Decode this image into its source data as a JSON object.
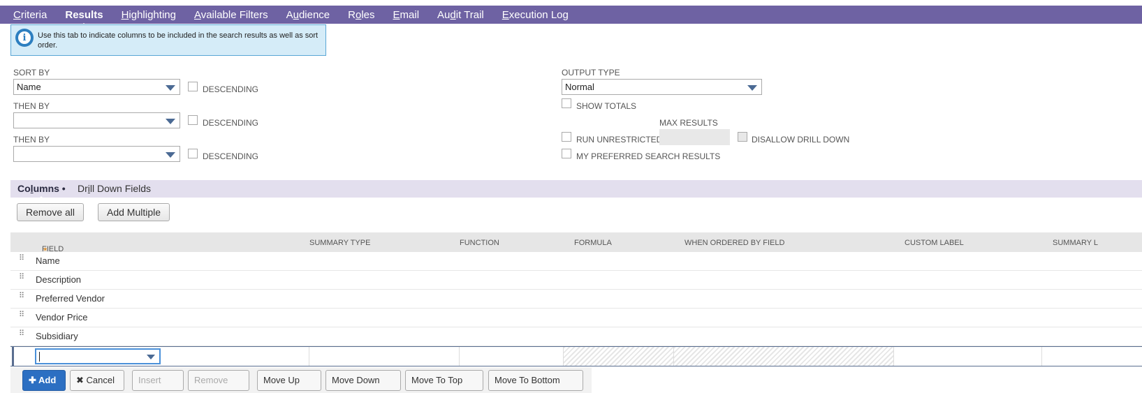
{
  "tabs": [
    {
      "pre": "",
      "u": "C",
      "post": "riteria"
    },
    {
      "pre": "",
      "u": "R",
      "post": "esults"
    },
    {
      "pre": "",
      "u": "H",
      "post": "ighlighting"
    },
    {
      "pre": "",
      "u": "A",
      "post": "vailable Filters"
    },
    {
      "pre": "A",
      "u": "u",
      "post": "dience"
    },
    {
      "pre": "R",
      "u": "o",
      "post": "les"
    },
    {
      "pre": "",
      "u": "E",
      "post": "mail"
    },
    {
      "pre": "Au",
      "u": "d",
      "post": "it Trail"
    },
    {
      "pre": "",
      "u": "E",
      "post": "xecution Log"
    }
  ],
  "info": {
    "text": "Use this tab to indicate columns to be included in the search results as well as sort order."
  },
  "sort": {
    "sort_by_label": "SORT BY",
    "sort_by_value": "Name",
    "then_by_label": "THEN BY",
    "then_by_1_value": "",
    "then_by_2_value": "",
    "descending_label": "DESCENDING"
  },
  "output": {
    "output_type_label": "OUTPUT TYPE",
    "output_type_value": "Normal",
    "show_totals": "SHOW TOTALS",
    "max_results": "MAX RESULTS",
    "run_unrestricted": "RUN UNRESTRICTED",
    "disallow_drill_down": "DISALLOW DRILL DOWN",
    "my_preferred": "MY PREFERRED SEARCH RESULTS"
  },
  "subtabs": {
    "columns": {
      "pre": "Co",
      "u": "l",
      "post": "umns •"
    },
    "drill": {
      "pre": "Dr",
      "u": "i",
      "post": "ll Down Fields"
    }
  },
  "buttons": {
    "remove_all": "Remove all",
    "add_multiple": "Add Multiple"
  },
  "grid": {
    "headers": {
      "field": "FIELD",
      "summary_type": "SUMMARY TYPE",
      "function": "FUNCTION",
      "formula": "FORMULA",
      "when_ordered": "WHEN ORDERED BY FIELD",
      "custom_label": "CUSTOM LABEL",
      "summary_label": "SUMMARY L"
    },
    "required_mark": "*",
    "rows": [
      "Name",
      "Description",
      "Preferred Vendor",
      "Vendor Price",
      "Subsidiary"
    ]
  },
  "bottom_buttons": {
    "add": "✚ Add",
    "cancel": "✖ Cancel",
    "insert": "Insert",
    "remove": "Remove",
    "move_up": "Move Up",
    "move_down": "Move Down",
    "move_to_top": "Move To Top",
    "move_to_bottom": "Move To Bottom"
  }
}
